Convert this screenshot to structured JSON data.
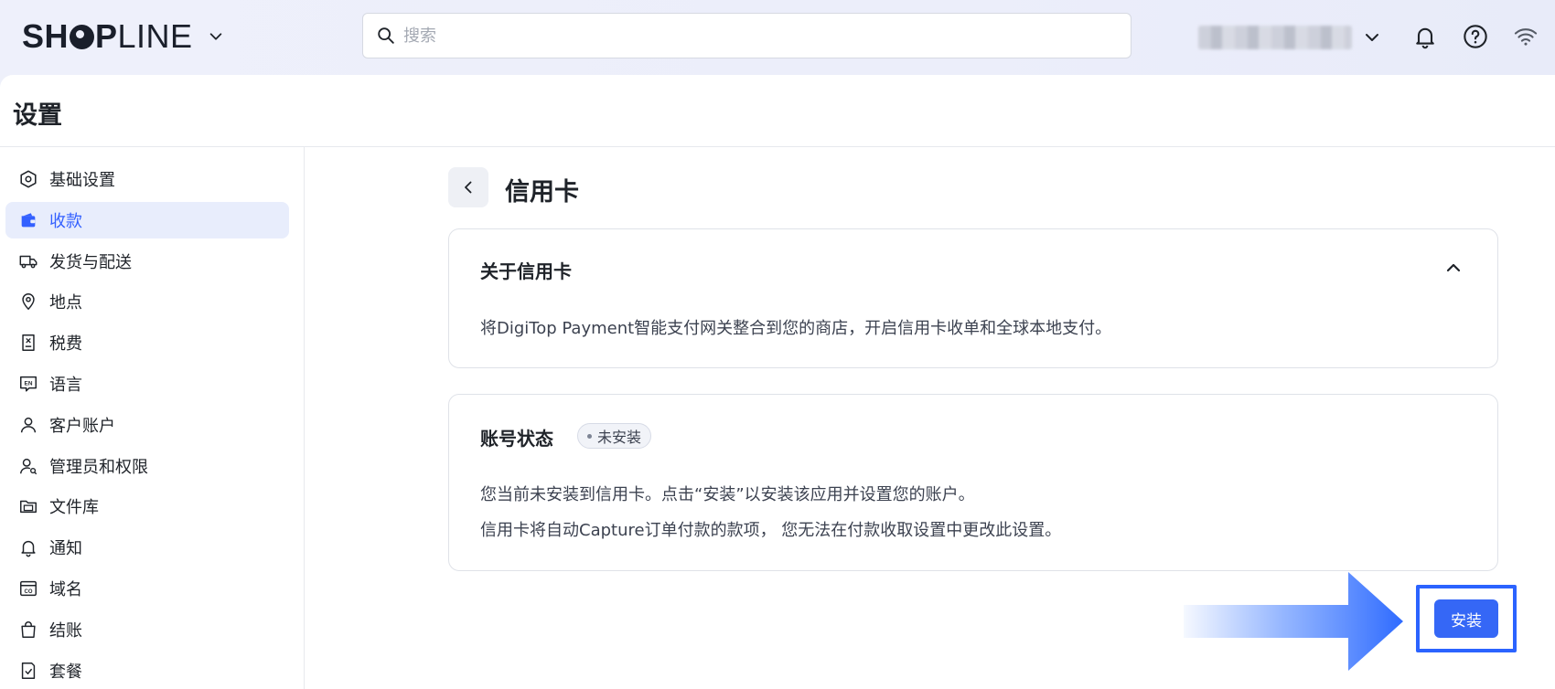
{
  "topbar": {
    "brand": {
      "text_bold": "SH",
      "text_bold2": "P",
      "text_light": "LINE"
    },
    "search": {
      "placeholder": "搜索"
    },
    "icons": [
      "chevron-down-icon",
      "search-icon",
      "bell-icon",
      "help-icon",
      "wifi-icon"
    ]
  },
  "page": {
    "title": "设置"
  },
  "sidebar": {
    "items": [
      {
        "label": "基础设置",
        "icon": "hexagon-settings-icon",
        "active": false
      },
      {
        "label": "收款",
        "icon": "wallet-icon",
        "active": true
      },
      {
        "label": "发货与配送",
        "icon": "truck-icon",
        "active": false
      },
      {
        "label": "地点",
        "icon": "location-pin-icon",
        "active": false
      },
      {
        "label": "税费",
        "icon": "receipt-icon",
        "active": false
      },
      {
        "label": "语言",
        "icon": "language-en-icon",
        "active": false
      },
      {
        "label": "客户账户",
        "icon": "user-icon",
        "active": false
      },
      {
        "label": "管理员和权限",
        "icon": "user-permission-icon",
        "active": false
      },
      {
        "label": "文件库",
        "icon": "folder-icon",
        "active": false
      },
      {
        "label": "通知",
        "icon": "bell-icon",
        "active": false
      },
      {
        "label": "域名",
        "icon": "domain-icon",
        "active": false
      },
      {
        "label": "结账",
        "icon": "shopping-bag-icon",
        "active": false
      },
      {
        "label": "套餐",
        "icon": "plan-icon",
        "active": false
      }
    ]
  },
  "content": {
    "title": "信用卡",
    "about_card": {
      "heading": "关于信用卡",
      "description": "将DigiTop Payment智能支付网关整合到您的商店，开启信用卡收单和全球本地支付。"
    },
    "status_card": {
      "heading": "账号状态",
      "badge": "未安装",
      "line1": "您当前未安装到信用卡。点击“安装”以安装该应用并设置您的账户。",
      "line2": "信用卡将自动Capture订单付款的款项， 您无法在付款收取设置中更改此设置。"
    },
    "install_label": "安装"
  },
  "colors": {
    "accent": "#3567f6",
    "active_nav_bg": "#e8edfc",
    "active_nav_text": "#3360ff",
    "highlight_frame": "#2b63ff"
  }
}
